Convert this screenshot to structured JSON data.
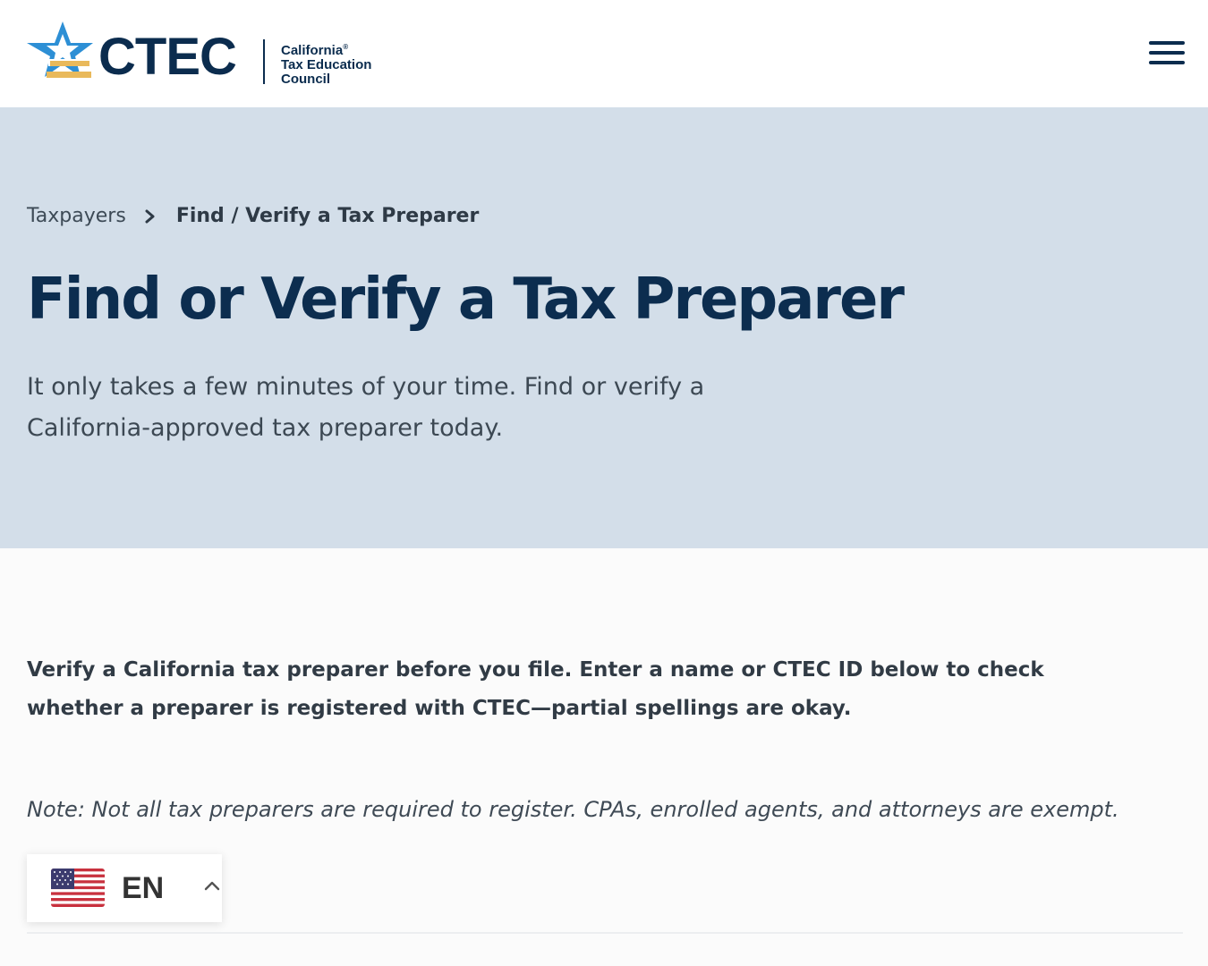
{
  "header": {
    "logo": {
      "wordmark": "CTEC",
      "subtitle_lines": [
        "California",
        "Tax Education",
        "Council"
      ],
      "registered_mark": "®"
    },
    "menu_icon": "hamburger-menu-icon"
  },
  "hero": {
    "breadcrumb": {
      "parent": "Taxpayers",
      "separator_icon": "chevron-right-icon",
      "current": "Find / Verify a Tax Preparer"
    },
    "title": "Find or Verify a Tax Preparer",
    "lead": "It only takes a few minutes of your time. Find or verify a California-approved tax preparer today."
  },
  "main": {
    "intro": "Verify a California tax preparer before you file. Enter a name or CTEC ID below to check whether a preparer is registered with CTEC—partial spellings are okay.",
    "note": "Note: Not all tax preparers are required to register. CPAs, enrolled agents, and attorneys are exempt."
  },
  "language_switcher": {
    "code": "EN",
    "flag_icon": "us-flag-icon",
    "caret_icon": "chevron-up-icon"
  },
  "colors": {
    "brand_navy": "#0b2c4e",
    "brand_blue": "#2d8fd5",
    "brand_gold": "#e9b95b",
    "hero_bg": "#d3dee9"
  }
}
